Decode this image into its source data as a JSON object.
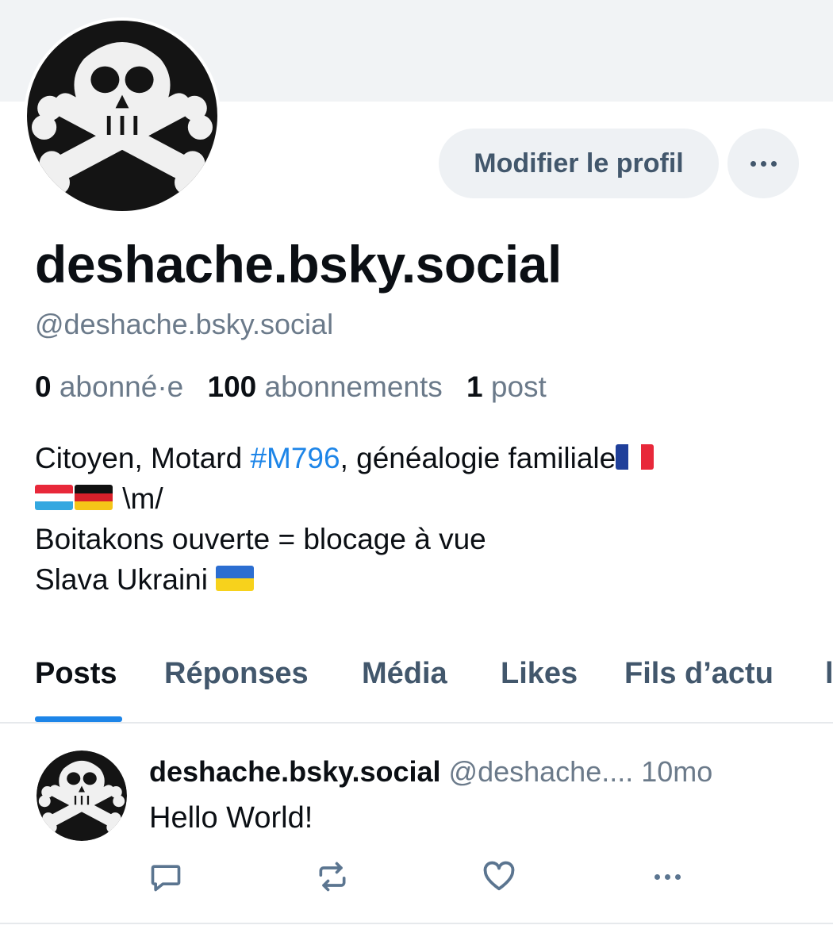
{
  "profile": {
    "display_name": "deshache.bsky.social",
    "handle": "@deshache.bsky.social",
    "edit_button": "Modifier le profil",
    "stats": {
      "followers_count": "0",
      "followers_label": "abonné·e",
      "following_count": "100",
      "following_label": "abonnements",
      "posts_count": "1",
      "posts_label": "post"
    },
    "bio": {
      "line1_prefix": "Citoyen, Motard ",
      "line1_hashtag": "#M796",
      "line1_suffix": ", généalogie familiale",
      "line2_text": " \\m/",
      "line3": "Boitakons ouverte = blocage à vue",
      "line4": "Slava Ukraini "
    }
  },
  "tabs": [
    "Posts",
    "Réponses",
    "Média",
    "Likes",
    "Fils d’actu"
  ],
  "post": {
    "author": "deshache.bsky.social",
    "handle": "@deshache....",
    "time": "10mo",
    "text": "Hello World!"
  },
  "icons": {
    "reply": "comment-icon",
    "repost": "repost-icon",
    "like": "heart-icon",
    "more": "more-dots-icon",
    "flags": [
      "france-flag",
      "luxembourg-flag",
      "germany-flag",
      "ukraine-flag"
    ]
  },
  "colors": {
    "accent": "#1d85e8",
    "muted": "#6b7a8a",
    "button_bg": "#eef1f4",
    "button_text": "#42576c"
  }
}
